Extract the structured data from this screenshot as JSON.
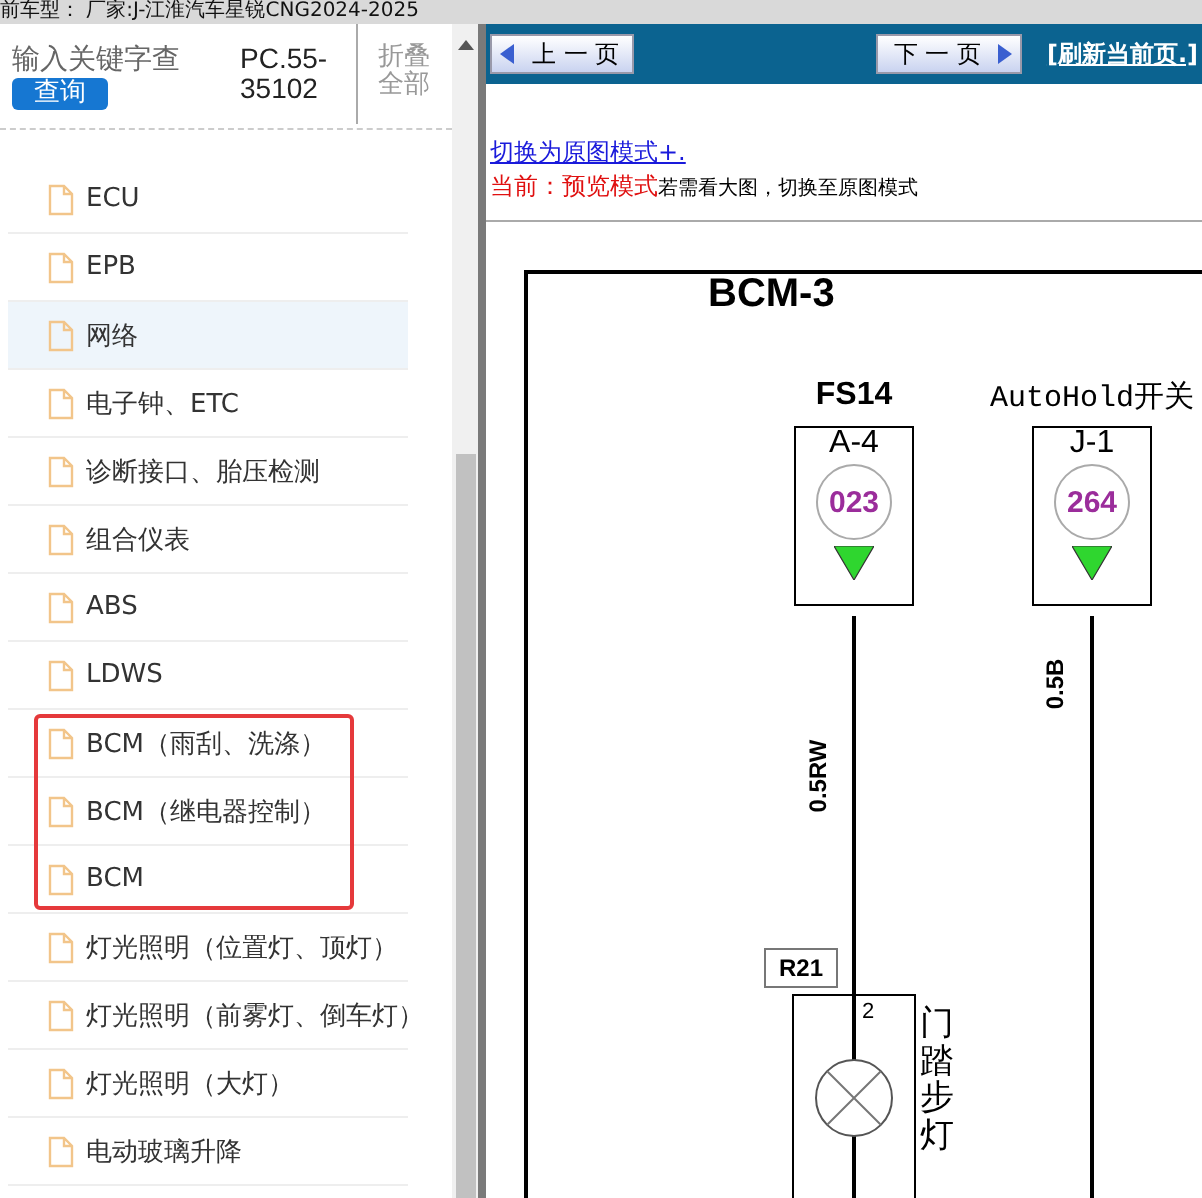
{
  "title_bar": {
    "text": "前车型： 厂家:J-江淮汽车星锐CNG2024-2025"
  },
  "sidebar": {
    "search": {
      "placeholder": "输入关键字查"
    },
    "search_button": "查询",
    "code": "PC.55-35102",
    "collapse_all": "折叠全部",
    "items": [
      {
        "label": "ECU",
        "selected": false,
        "highlighted": false
      },
      {
        "label": "EPB",
        "selected": false,
        "highlighted": false
      },
      {
        "label": "网络",
        "selected": true,
        "highlighted": false
      },
      {
        "label": "电子钟、ETC",
        "selected": false,
        "highlighted": false
      },
      {
        "label": "诊断接口、胎压检测",
        "selected": false,
        "highlighted": false
      },
      {
        "label": "组合仪表",
        "selected": false,
        "highlighted": false
      },
      {
        "label": "ABS",
        "selected": false,
        "highlighted": false
      },
      {
        "label": "LDWS",
        "selected": false,
        "highlighted": false
      },
      {
        "label": "BCM（雨刮、洗涤）",
        "selected": false,
        "highlighted": true
      },
      {
        "label": "BCM（继电器控制）",
        "selected": false,
        "highlighted": true
      },
      {
        "label": "BCM",
        "selected": false,
        "highlighted": true
      },
      {
        "label": "灯光照明（位置灯、顶灯）",
        "selected": false,
        "highlighted": false
      },
      {
        "label": "灯光照明（前雾灯、倒车灯）",
        "selected": false,
        "highlighted": false
      },
      {
        "label": "灯光照明（大灯）",
        "selected": false,
        "highlighted": false
      },
      {
        "label": "电动玻璃升降",
        "selected": false,
        "highlighted": false
      }
    ]
  },
  "toolbar": {
    "prev": "上 一 页",
    "next": "下 一 页",
    "refresh": "[刷新当前页.]"
  },
  "mode_link": "切换为原图模式+.",
  "mode_status": {
    "label": "当前：预览模式",
    "hint": "若需看大图，切换至原图模式"
  },
  "diagram": {
    "title": "BCM-3",
    "connectors": [
      {
        "label": "FS14",
        "pin": "A-4",
        "circuit": "023",
        "wire": "0.5RW"
      },
      {
        "label": "AutoHold开关",
        "pin": "J-1",
        "circuit": "264",
        "wire": "0.5B"
      }
    ],
    "splice": "R21",
    "lamp": {
      "pin": "2",
      "label": "门踏步灯"
    }
  }
}
